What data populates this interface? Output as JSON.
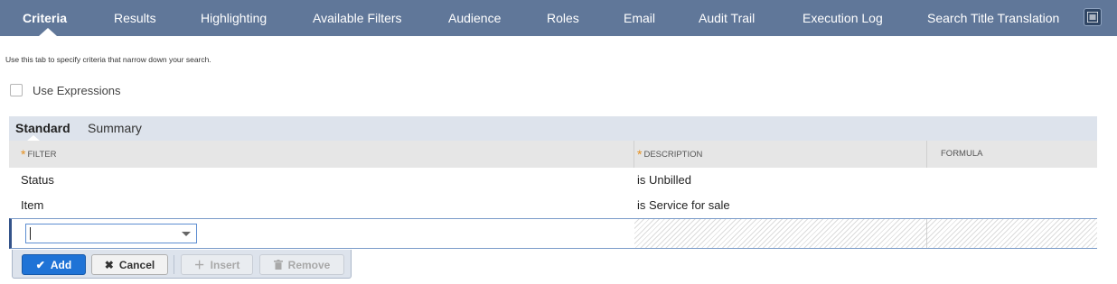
{
  "tabs": [
    {
      "label": "Criteria",
      "active": true
    },
    {
      "label": "Results"
    },
    {
      "label": "Highlighting"
    },
    {
      "label": "Available Filters"
    },
    {
      "label": "Audience"
    },
    {
      "label": "Roles"
    },
    {
      "label": "Email"
    },
    {
      "label": "Audit Trail"
    },
    {
      "label": "Execution Log"
    },
    {
      "label": "Search Title Translation"
    }
  ],
  "menu_icon": "hamburger-menu-icon",
  "help_text": "Use this tab to specify criteria that narrow down your search.",
  "use_expressions": {
    "label": "Use Expressions",
    "checked": false
  },
  "subtabs": [
    {
      "label": "Standard",
      "active": true
    },
    {
      "label": "Summary"
    }
  ],
  "table": {
    "columns": [
      {
        "label": "FILTER",
        "required": true
      },
      {
        "label": "DESCRIPTION",
        "required": true
      },
      {
        "label": "FORMULA",
        "required": false
      }
    ],
    "required_marker": "*",
    "rows": [
      {
        "filter": "Status",
        "description": "is Unbilled",
        "formula": ""
      },
      {
        "filter": "Item",
        "description": "is Service for sale",
        "formula": ""
      }
    ],
    "edit_row": {
      "filter_value": ""
    }
  },
  "buttons": {
    "add": {
      "label": "Add",
      "icon": "check-icon"
    },
    "cancel": {
      "label": "Cancel",
      "icon": "x-icon"
    },
    "insert": {
      "label": "Insert",
      "icon": "plus-icon",
      "enabled": false
    },
    "remove": {
      "label": "Remove",
      "icon": "trash-icon",
      "enabled": false
    }
  },
  "colors": {
    "tabbar": "#607799",
    "accent_button": "#1f73d6",
    "required_star": "#e58f1e"
  }
}
